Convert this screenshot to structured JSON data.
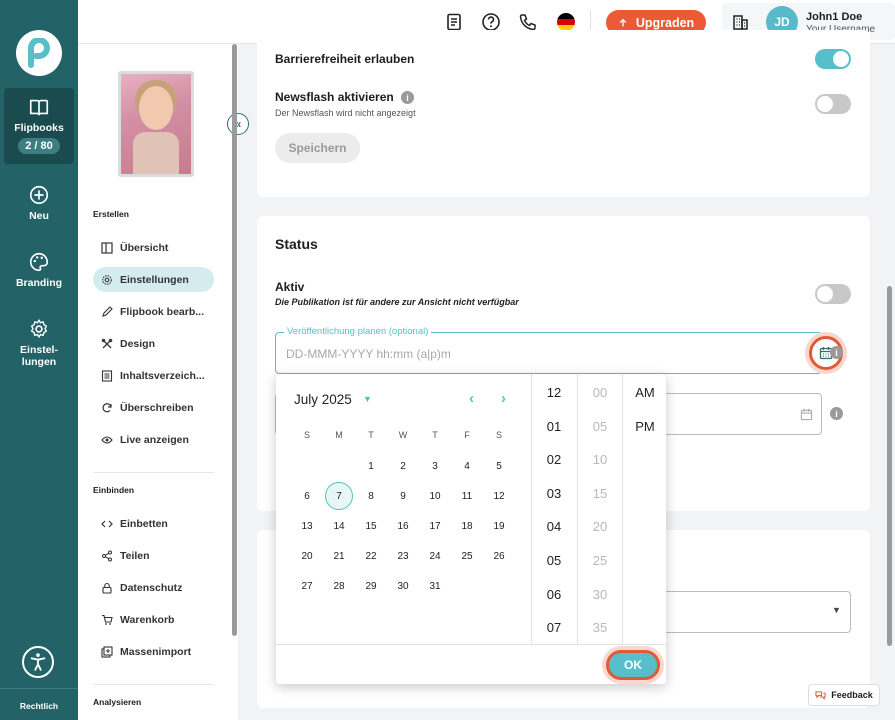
{
  "colors": {
    "rail": "#236266",
    "accent": "#57bfc9",
    "upgrade": "#ea5a35",
    "highlight": "#e15a37"
  },
  "rail": {
    "items": [
      {
        "label": "Flipbooks",
        "icon": "book-icon",
        "badge": "2 / 80"
      },
      {
        "label": "Neu",
        "icon": "plus-circle-icon"
      },
      {
        "label": "Branding",
        "icon": "palette-icon"
      },
      {
        "label": "Einstel-\nlungen",
        "icon": "gear-icon"
      }
    ],
    "legal": "Rechtlich"
  },
  "topbar": {
    "upgrade_label": "Upgraden",
    "avatar_initials": "JD",
    "user_name": "John1 Doe",
    "user_sub": "Your Username"
  },
  "sidebar": {
    "section_create": "Erstellen",
    "create_items": [
      {
        "label": "Übersicht",
        "icon": "layout-icon"
      },
      {
        "label": "Einstellungen",
        "icon": "gear-icon"
      },
      {
        "label": "Flipbook bearb...",
        "icon": "pencil-icon"
      },
      {
        "label": "Design",
        "icon": "design-icon"
      },
      {
        "label": "Inhaltsverzeich...",
        "icon": "list-icon"
      },
      {
        "label": "Überschreiben",
        "icon": "refresh-icon"
      },
      {
        "label": "Live anzeigen",
        "icon": "eye-icon"
      }
    ],
    "section_embed": "Einbinden",
    "embed_items": [
      {
        "label": "Einbetten",
        "icon": "code-icon"
      },
      {
        "label": "Teilen",
        "icon": "share-icon"
      },
      {
        "label": "Datenschutz",
        "icon": "lock-icon"
      },
      {
        "label": "Warenkorb",
        "icon": "cart-icon"
      },
      {
        "label": "Massenimport",
        "icon": "import-icon"
      }
    ],
    "section_analyze": "Analysieren"
  },
  "settings": {
    "accessibility_label": "Barrierefreiheit erlauben",
    "newsflash_label": "Newsflash aktivieren",
    "newsflash_sub": "Der Newsflash wird nicht angezeigt",
    "save_label": "Speichern"
  },
  "status": {
    "title": "Status",
    "active_label": "Aktiv",
    "active_sub": "Die Publikation ist für andere zur Ansicht nicht verfügbar",
    "schedule_legend": "Veröffentlichung planen (optional)",
    "schedule_placeholder": "DD-MMM-YYYY hh:mm (a|p)m"
  },
  "picker": {
    "month_label": "July 2025",
    "weekdays": [
      "S",
      "M",
      "T",
      "W",
      "T",
      "F",
      "S"
    ],
    "first_weekday_index": 2,
    "days_in_month": 31,
    "selected_day": "7",
    "hours": [
      "12",
      "01",
      "02",
      "03",
      "04",
      "05",
      "06",
      "07"
    ],
    "minutes": [
      "00",
      "05",
      "10",
      "15",
      "20",
      "25",
      "30",
      "35"
    ],
    "ampm": [
      "AM",
      "PM"
    ],
    "ok_label": "OK"
  },
  "feedback_label": "Feedback"
}
